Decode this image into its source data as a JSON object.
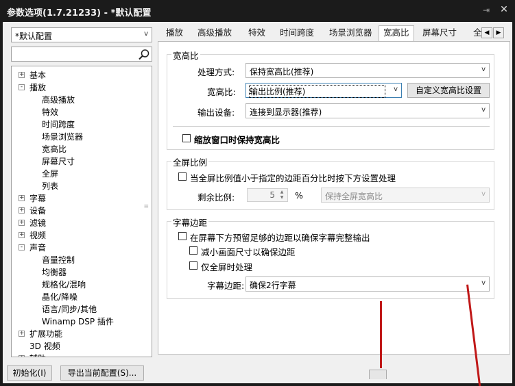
{
  "window": {
    "title": "参数选项(1.7.21233) - *默认配置"
  },
  "left": {
    "profile_select": "*默认配置",
    "search_placeholder": "",
    "tree": [
      {
        "label": "基本",
        "indent": 0,
        "expander": "+"
      },
      {
        "label": "播放",
        "indent": 0,
        "expander": "-"
      },
      {
        "label": "高级播放",
        "indent": 1,
        "expander": ""
      },
      {
        "label": "特效",
        "indent": 1,
        "expander": ""
      },
      {
        "label": "时间跨度",
        "indent": 1,
        "expander": ""
      },
      {
        "label": "场景浏览器",
        "indent": 1,
        "expander": ""
      },
      {
        "label": "宽高比",
        "indent": 1,
        "expander": ""
      },
      {
        "label": "屏幕尺寸",
        "indent": 1,
        "expander": ""
      },
      {
        "label": "全屏",
        "indent": 1,
        "expander": ""
      },
      {
        "label": "列表",
        "indent": 1,
        "expander": ""
      },
      {
        "label": "字幕",
        "indent": 0,
        "expander": "+"
      },
      {
        "label": "设备",
        "indent": 0,
        "expander": "+"
      },
      {
        "label": "滤镜",
        "indent": 0,
        "expander": "+"
      },
      {
        "label": "视频",
        "indent": 0,
        "expander": "+"
      },
      {
        "label": "声音",
        "indent": 0,
        "expander": "-"
      },
      {
        "label": "音量控制",
        "indent": 1,
        "expander": ""
      },
      {
        "label": "均衡器",
        "indent": 1,
        "expander": ""
      },
      {
        "label": "规格化/混响",
        "indent": 1,
        "expander": ""
      },
      {
        "label": "晶化/降噪",
        "indent": 1,
        "expander": ""
      },
      {
        "label": "语言/同步/其他",
        "indent": 1,
        "expander": ""
      },
      {
        "label": "Winamp DSP 插件",
        "indent": 1,
        "expander": ""
      },
      {
        "label": "扩展功能",
        "indent": 0,
        "expander": "+"
      },
      {
        "label": "3D 视频",
        "indent": 0,
        "expander": ""
      },
      {
        "label": "辅助",
        "indent": 0,
        "expander": "+"
      }
    ]
  },
  "bottom": {
    "reset_button": "初始化(I)",
    "export_button": "导出当前配置(S)..."
  },
  "tabs": [
    "播放",
    "高级播放",
    "特效",
    "时间跨度",
    "场景浏览器",
    "宽高比",
    "屏幕尺寸",
    "全"
  ],
  "active_tab": "宽高比",
  "aspect_group": {
    "title": "宽高比",
    "method_label": "处理方式:",
    "method_value": "保持宽高比(推荐)",
    "ratio_label": "宽高比:",
    "ratio_value": "输出比例(推荐)",
    "custom_button": "自定义宽高比设置",
    "device_label": "输出设备:",
    "device_value": "连接到显示器(推荐)",
    "keep_on_shrink": "缩放窗口时保持宽高比"
  },
  "fullscreen_group": {
    "title": "全屏比例",
    "margin_check": "当全屏比例值小于指定的边距百分比时按下方设置处理",
    "remain_label": "剩余比例:",
    "remain_value": "5",
    "percent": "%",
    "remain_mode": "保持全屏宽高比"
  },
  "subtitle_group": {
    "title": "字幕边距",
    "reserve_check": "在屏幕下方预留足够的边距以确保字幕完整输出",
    "shrink_check": "减小画面尺寸以确保边距",
    "fullscreen_only_check": "仅全屏时处理",
    "margin_label": "字幕边距:",
    "margin_value": "确保2行字幕"
  },
  "colors": {
    "title_bar": "#1b1b1b",
    "annotation_red": "#c01818"
  }
}
